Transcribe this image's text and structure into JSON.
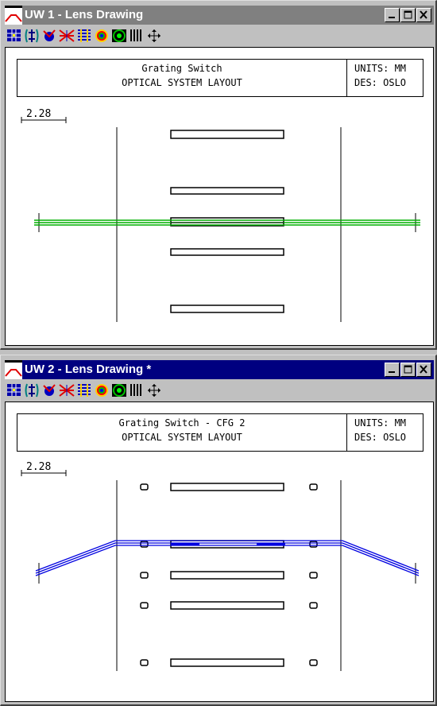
{
  "window1": {
    "title": "UW 1 - Lens Drawing",
    "header": {
      "title_line1": "Grating Switch",
      "title_line2": "OPTICAL SYSTEM LAYOUT",
      "units": "UNITS: MM",
      "designer": "DES: OSLO"
    },
    "scale_label": "2.28",
    "ray_color": "#00b000"
  },
  "window2": {
    "title": "UW 2 - Lens Drawing *",
    "header": {
      "title_line1": "Grating Switch - CFG 2",
      "title_line2": "OPTICAL SYSTEM LAYOUT",
      "units": "UNITS: MM",
      "designer": "DES: OSLO"
    },
    "scale_label": "2.28",
    "ray_color": "#0000e0"
  },
  "toolbar_icons": [
    "lens-table-icon",
    "surface-icon",
    "ray-fan-icon",
    "spot-icon",
    "wavefront-icon",
    "mtf-icon",
    "psf-icon",
    "grid-icon",
    "pan-icon"
  ],
  "colors": {
    "active_titlebar": "#000080",
    "inactive_titlebar": "#808080",
    "chrome": "#c0c0c0"
  }
}
